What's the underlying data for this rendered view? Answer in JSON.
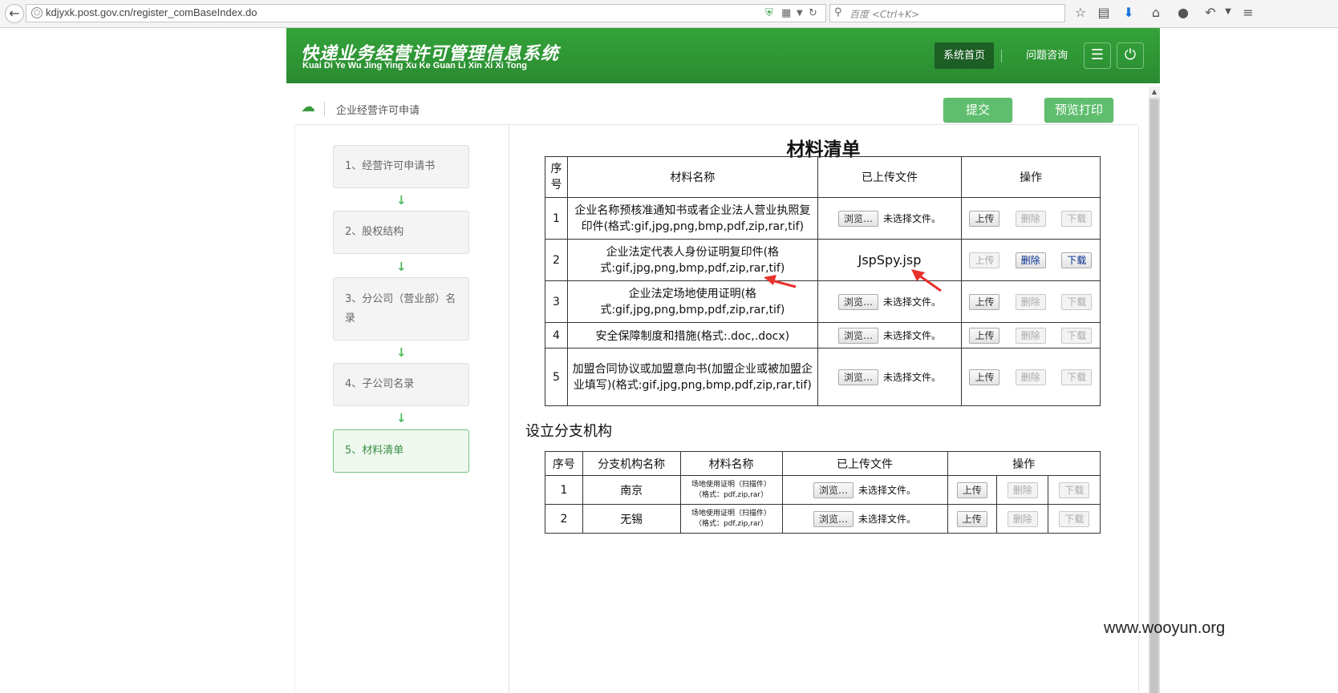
{
  "browser": {
    "url": "kdjyxk.post.gov.cn/register_comBaseIndex.do",
    "search_placeholder": "百度 <Ctrl+K>"
  },
  "site": {
    "title": "快递业务经营许可管理信息系统",
    "subtitle": "Kuai Di Ye Wu Jing Ying Xu Ke Guan Li Xin Xi Xi Tong",
    "nav_home": "系统首页",
    "nav_help": "问题咨询"
  },
  "subheader": {
    "breadcrumb": "企业经营许可申请",
    "submit_label": "提交",
    "print_label": "预览打印"
  },
  "steps": [
    {
      "label": "1、经营许可申请书",
      "active": false
    },
    {
      "label": "2、股权结构",
      "active": false
    },
    {
      "label": "3、分公司（营业部）名录",
      "active": false
    },
    {
      "label": "4、子公司名录",
      "active": false
    },
    {
      "label": "5、材料清单",
      "active": true
    }
  ],
  "main": {
    "title": "材料清单",
    "headers": {
      "index": "序号",
      "name": "材料名称",
      "uploaded": "已上传文件",
      "action": "操作"
    },
    "rows": [
      {
        "index": "1",
        "name": "企业名称预核准通知书或者企业法人营业执照复印件(格式:gif,jpg,png,bmp,pdf,zip,rar,tif)",
        "file": null
      },
      {
        "index": "2",
        "name": "企业法定代表人身份证明复印件(格式:gif,jpg,png,bmp,pdf,zip,rar,tif)",
        "file": "JspSpy.jsp"
      },
      {
        "index": "3",
        "name": "企业法定场地使用证明(格式:gif,jpg,png,bmp,pdf,zip,rar,tif)",
        "file": null
      },
      {
        "index": "4",
        "name": "安全保障制度和措施(格式:.doc,.docx)",
        "file": null
      },
      {
        "index": "5",
        "name": "加盟合同协议或加盟意向书(加盟企业或被加盟企业填写)(格式:gif,jpg,png,bmp,pdf,zip,rar,tif)",
        "file": null
      }
    ],
    "browse_label": "浏览…",
    "no_file_label": "未选择文件。",
    "upload_label": "上传",
    "delete_label": "删除",
    "download_label": "下载"
  },
  "branch": {
    "title": "设立分支机构",
    "headers": {
      "index": "序号",
      "branch_name": "分支机构名称",
      "material": "材料名称",
      "uploaded": "已上传文件",
      "action": "操作"
    },
    "rows": [
      {
        "index": "1",
        "branch_name": "南京",
        "material_line1": "场地使用证明（扫描件）",
        "material_line2": "（格式：pdf,zip,rar）"
      },
      {
        "index": "2",
        "branch_name": "无锡",
        "material_line1": "场地使用证明（扫描件）",
        "material_line2": "（格式：pdf,zip,rar）"
      }
    ]
  },
  "watermark": "www.wooyun.org",
  "colors": {
    "header_green": "#2e9634",
    "button_green": "#5fbe6e",
    "active_step": "#74c47c",
    "arrow_red": "#e8302c"
  }
}
